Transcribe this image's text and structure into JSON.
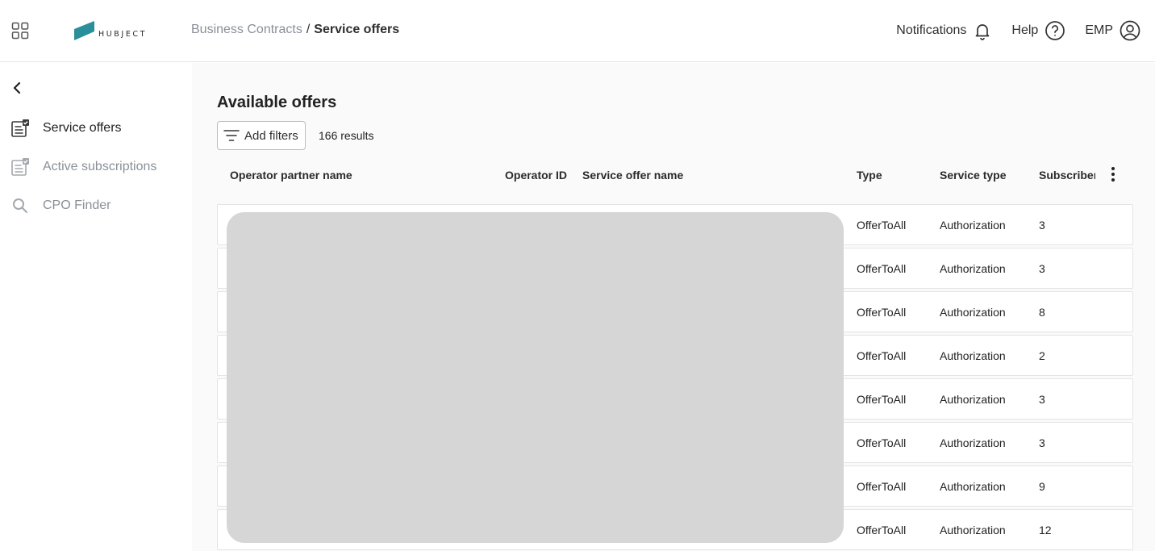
{
  "header": {
    "logo_text": "HUBJECT",
    "breadcrumb_parent": "Business Contracts",
    "breadcrumb_separator": "/",
    "breadcrumb_current": "Service offers",
    "notifications_label": "Notifications",
    "help_label": "Help",
    "user_label": "EMP",
    "icons": [
      "apps-grid-icon",
      "bell-icon",
      "help-circle-icon",
      "user-circle-icon"
    ]
  },
  "sidebar": {
    "items": [
      {
        "label": "Service offers",
        "icon": "service-offers-icon",
        "active": true
      },
      {
        "label": "Active subscriptions",
        "icon": "subscriptions-icon",
        "active": false
      },
      {
        "label": "CPO Finder",
        "icon": "search-icon",
        "active": false
      }
    ]
  },
  "main": {
    "title": "Available offers",
    "filter_label": "Add filters",
    "results": "166 results",
    "columns": [
      "Operator partner name",
      "Operator ID",
      "Service offer name",
      "Type",
      "Service type",
      "Subscribers"
    ],
    "rows": [
      {
        "type": "OfferToAll",
        "service_type": "Authorization",
        "subscribers": "3"
      },
      {
        "type": "OfferToAll",
        "service_type": "Authorization",
        "subscribers": "3"
      },
      {
        "type": "OfferToAll",
        "service_type": "Authorization",
        "subscribers": "8"
      },
      {
        "type": "OfferToAll",
        "service_type": "Authorization",
        "subscribers": "2"
      },
      {
        "type": "OfferToAll",
        "service_type": "Authorization",
        "subscribers": "3"
      },
      {
        "type": "OfferToAll",
        "service_type": "Authorization",
        "subscribers": "3"
      },
      {
        "type": "OfferToAll",
        "service_type": "Authorization",
        "subscribers": "9"
      },
      {
        "type": "OfferToAll",
        "service_type": "Authorization",
        "subscribers": "12"
      }
    ]
  },
  "colors": {
    "brand_teal": "#2a8f9a",
    "muted_text": "#8a8f98",
    "redaction": "#d6d6d6"
  }
}
